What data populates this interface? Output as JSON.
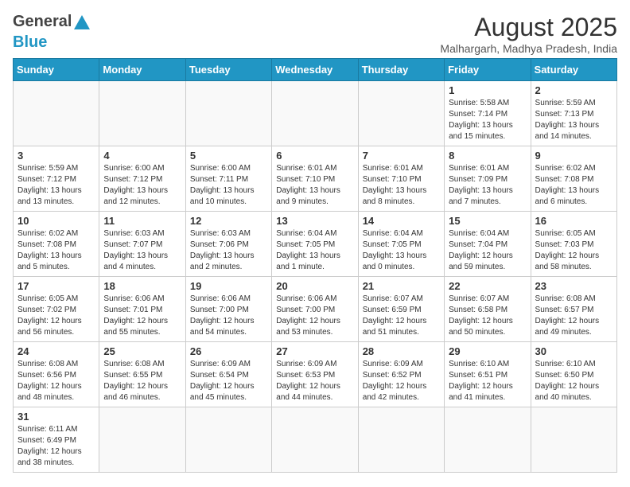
{
  "header": {
    "logo_line1": "General",
    "logo_line2": "Blue",
    "month_year": "August 2025",
    "location": "Malhargarh, Madhya Pradesh, India"
  },
  "days_of_week": [
    "Sunday",
    "Monday",
    "Tuesday",
    "Wednesday",
    "Thursday",
    "Friday",
    "Saturday"
  ],
  "weeks": [
    [
      {
        "day": "",
        "info": ""
      },
      {
        "day": "",
        "info": ""
      },
      {
        "day": "",
        "info": ""
      },
      {
        "day": "",
        "info": ""
      },
      {
        "day": "",
        "info": ""
      },
      {
        "day": "1",
        "info": "Sunrise: 5:58 AM\nSunset: 7:14 PM\nDaylight: 13 hours and 15 minutes."
      },
      {
        "day": "2",
        "info": "Sunrise: 5:59 AM\nSunset: 7:13 PM\nDaylight: 13 hours and 14 minutes."
      }
    ],
    [
      {
        "day": "3",
        "info": "Sunrise: 5:59 AM\nSunset: 7:12 PM\nDaylight: 13 hours and 13 minutes."
      },
      {
        "day": "4",
        "info": "Sunrise: 6:00 AM\nSunset: 7:12 PM\nDaylight: 13 hours and 12 minutes."
      },
      {
        "day": "5",
        "info": "Sunrise: 6:00 AM\nSunset: 7:11 PM\nDaylight: 13 hours and 10 minutes."
      },
      {
        "day": "6",
        "info": "Sunrise: 6:01 AM\nSunset: 7:10 PM\nDaylight: 13 hours and 9 minutes."
      },
      {
        "day": "7",
        "info": "Sunrise: 6:01 AM\nSunset: 7:10 PM\nDaylight: 13 hours and 8 minutes."
      },
      {
        "day": "8",
        "info": "Sunrise: 6:01 AM\nSunset: 7:09 PM\nDaylight: 13 hours and 7 minutes."
      },
      {
        "day": "9",
        "info": "Sunrise: 6:02 AM\nSunset: 7:08 PM\nDaylight: 13 hours and 6 minutes."
      }
    ],
    [
      {
        "day": "10",
        "info": "Sunrise: 6:02 AM\nSunset: 7:08 PM\nDaylight: 13 hours and 5 minutes."
      },
      {
        "day": "11",
        "info": "Sunrise: 6:03 AM\nSunset: 7:07 PM\nDaylight: 13 hours and 4 minutes."
      },
      {
        "day": "12",
        "info": "Sunrise: 6:03 AM\nSunset: 7:06 PM\nDaylight: 13 hours and 2 minutes."
      },
      {
        "day": "13",
        "info": "Sunrise: 6:04 AM\nSunset: 7:05 PM\nDaylight: 13 hours and 1 minute."
      },
      {
        "day": "14",
        "info": "Sunrise: 6:04 AM\nSunset: 7:05 PM\nDaylight: 13 hours and 0 minutes."
      },
      {
        "day": "15",
        "info": "Sunrise: 6:04 AM\nSunset: 7:04 PM\nDaylight: 12 hours and 59 minutes."
      },
      {
        "day": "16",
        "info": "Sunrise: 6:05 AM\nSunset: 7:03 PM\nDaylight: 12 hours and 58 minutes."
      }
    ],
    [
      {
        "day": "17",
        "info": "Sunrise: 6:05 AM\nSunset: 7:02 PM\nDaylight: 12 hours and 56 minutes."
      },
      {
        "day": "18",
        "info": "Sunrise: 6:06 AM\nSunset: 7:01 PM\nDaylight: 12 hours and 55 minutes."
      },
      {
        "day": "19",
        "info": "Sunrise: 6:06 AM\nSunset: 7:00 PM\nDaylight: 12 hours and 54 minutes."
      },
      {
        "day": "20",
        "info": "Sunrise: 6:06 AM\nSunset: 7:00 PM\nDaylight: 12 hours and 53 minutes."
      },
      {
        "day": "21",
        "info": "Sunrise: 6:07 AM\nSunset: 6:59 PM\nDaylight: 12 hours and 51 minutes."
      },
      {
        "day": "22",
        "info": "Sunrise: 6:07 AM\nSunset: 6:58 PM\nDaylight: 12 hours and 50 minutes."
      },
      {
        "day": "23",
        "info": "Sunrise: 6:08 AM\nSunset: 6:57 PM\nDaylight: 12 hours and 49 minutes."
      }
    ],
    [
      {
        "day": "24",
        "info": "Sunrise: 6:08 AM\nSunset: 6:56 PM\nDaylight: 12 hours and 48 minutes."
      },
      {
        "day": "25",
        "info": "Sunrise: 6:08 AM\nSunset: 6:55 PM\nDaylight: 12 hours and 46 minutes."
      },
      {
        "day": "26",
        "info": "Sunrise: 6:09 AM\nSunset: 6:54 PM\nDaylight: 12 hours and 45 minutes."
      },
      {
        "day": "27",
        "info": "Sunrise: 6:09 AM\nSunset: 6:53 PM\nDaylight: 12 hours and 44 minutes."
      },
      {
        "day": "28",
        "info": "Sunrise: 6:09 AM\nSunset: 6:52 PM\nDaylight: 12 hours and 42 minutes."
      },
      {
        "day": "29",
        "info": "Sunrise: 6:10 AM\nSunset: 6:51 PM\nDaylight: 12 hours and 41 minutes."
      },
      {
        "day": "30",
        "info": "Sunrise: 6:10 AM\nSunset: 6:50 PM\nDaylight: 12 hours and 40 minutes."
      }
    ],
    [
      {
        "day": "31",
        "info": "Sunrise: 6:11 AM\nSunset: 6:49 PM\nDaylight: 12 hours and 38 minutes."
      },
      {
        "day": "",
        "info": ""
      },
      {
        "day": "",
        "info": ""
      },
      {
        "day": "",
        "info": ""
      },
      {
        "day": "",
        "info": ""
      },
      {
        "day": "",
        "info": ""
      },
      {
        "day": "",
        "info": ""
      }
    ]
  ]
}
